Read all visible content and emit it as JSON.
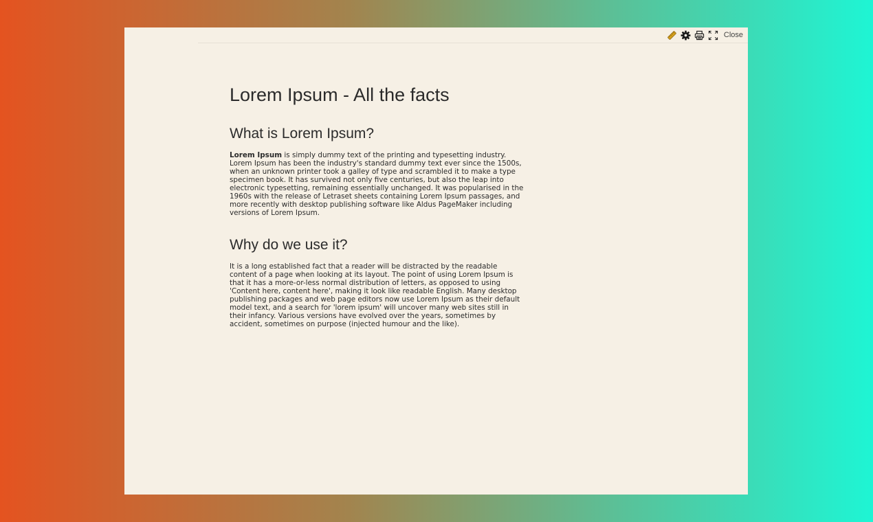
{
  "toolbar": {
    "icons": [
      "ruler-icon",
      "gear-icon",
      "printer-icon",
      "fullscreen-icon"
    ],
    "close_label": "Close",
    "ruler_color": "#d7a21d"
  },
  "article": {
    "title": "Lorem Ipsum - All the facts",
    "sections": [
      {
        "heading": "What is Lorem Ipsum?",
        "lead_bold": "Lorem Ipsum",
        "body": " is simply dummy text of the printing and typesetting industry. Lorem Ipsum has been the industry's standard dummy text ever since the 1500s, when an unknown printer took a galley of type and scrambled it to make a type specimen book. It has survived not only five centuries, but also the leap into electronic typesetting, remaining essentially unchanged. It was popularised in the 1960s with the release of Letraset sheets containing Lorem Ipsum passages, and more recently with desktop publishing software like Aldus PageMaker including versions of Lorem Ipsum."
      },
      {
        "heading": "Why do we use it?",
        "body": "It is a long established fact that a reader will be distracted by the readable content of a page when looking at its layout. The point of using Lorem Ipsum is that it has a more-or-less normal distribution of letters, as opposed to using 'Content here, content here', making it look like readable English. Many desktop publishing packages and web page editors now use Lorem Ipsum as their default model text, and a search for 'lorem ipsum' will uncover many web sites still in their infancy. Various versions have evolved over the years, sometimes by accident, sometimes on purpose (injected humour and the like)."
      }
    ]
  }
}
